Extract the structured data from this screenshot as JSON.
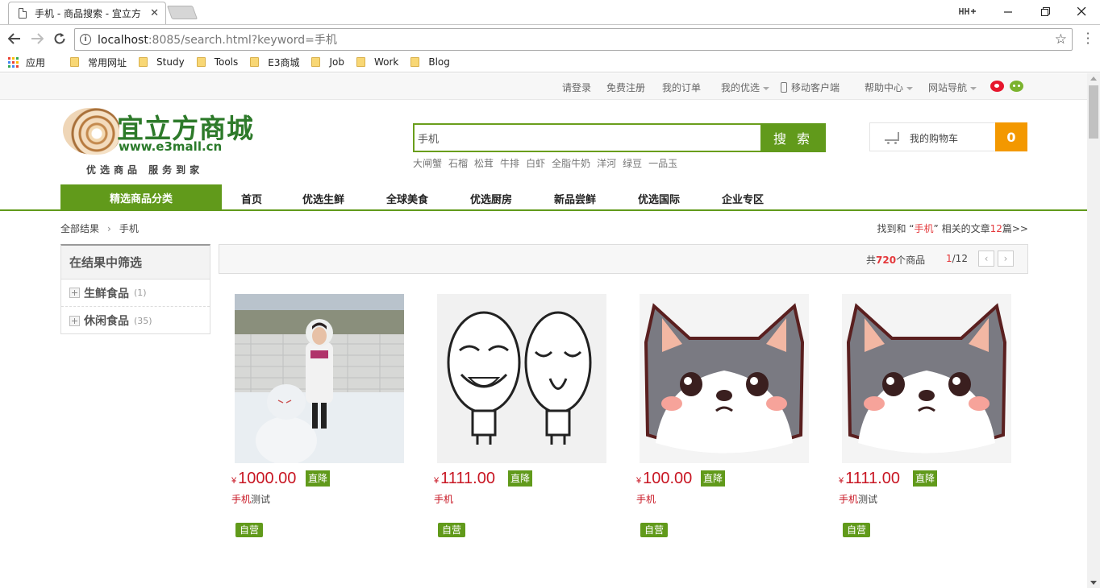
{
  "browser": {
    "tab_title": "手机 - 商品搜索 - 宜立方",
    "tab_close": "✕",
    "url_host": "localhost",
    "url_rest": ":8085/search.html?keyword=手机",
    "bookmarks": [
      "应用",
      "常用网址",
      "Study",
      "Tools",
      "E3商城",
      "Job",
      "Work",
      "Blog"
    ]
  },
  "topbar": {
    "login": "请登录",
    "register": "免费注册",
    "orders": "我的订单",
    "my_select": "我的优选",
    "mobile": "移动客户端",
    "help": "帮助中心",
    "site_nav": "网站导航"
  },
  "logo": {
    "brand": "宜立方商城",
    "url": "www.e3mall.cn",
    "slogan": "优选商品  服务到家"
  },
  "search": {
    "value": "手机",
    "button": "搜 索",
    "hotwords": [
      "大闸蟹",
      "石榴",
      "松茸",
      "牛排",
      "白虾",
      "全脂牛奶",
      "洋河",
      "绿豆",
      "一品玉"
    ]
  },
  "cart": {
    "label": "我的购物车",
    "count": "0"
  },
  "nav": {
    "all_categories": "精选商品分类",
    "items": [
      "首页",
      "优选生鲜",
      "全球美食",
      "优选厨房",
      "新品尝鲜",
      "优选国际",
      "企业专区"
    ]
  },
  "breadcrumb": {
    "root": "全部结果",
    "sep": "›",
    "current": "手机"
  },
  "related": {
    "prefix": "找到和 “",
    "keyword": "手机",
    "middle": "” 相关的文章",
    "count": "12",
    "suffix": "篇>>"
  },
  "filter": {
    "title": "在结果中筛选",
    "items": [
      {
        "label": "生鲜食品",
        "count": "(1)"
      },
      {
        "label": "休闲食品",
        "count": "(35)"
      }
    ]
  },
  "results": {
    "total_prefix": "共",
    "total": "720",
    "total_suffix": "个商品",
    "page_current": "1",
    "page_total": "/12",
    "prev": "‹",
    "next": "›"
  },
  "products": [
    {
      "currency": "¥",
      "price": "1000.00",
      "drop_tag": "直降",
      "name_kw": "手机",
      "name_rest": "测试",
      "self_tag": "自营",
      "image": "photo-girl-snowman"
    },
    {
      "currency": "¥",
      "price": "1111.00",
      "drop_tag": "直降",
      "name_kw": "手机",
      "name_rest": "",
      "self_tag": "自营",
      "image": "meme-faces"
    },
    {
      "currency": "¥",
      "price": "100.00",
      "drop_tag": "直降",
      "name_kw": "手机",
      "name_rest": "",
      "self_tag": "自营",
      "image": "husky-cartoon"
    },
    {
      "currency": "¥",
      "price": "1111.00",
      "drop_tag": "直降",
      "name_kw": "手机",
      "name_rest": "测试",
      "self_tag": "自营",
      "image": "husky-cartoon"
    }
  ],
  "colors": {
    "accent_green": "#619a1b",
    "price_red": "#c81623",
    "cart_orange": "#f39800"
  }
}
